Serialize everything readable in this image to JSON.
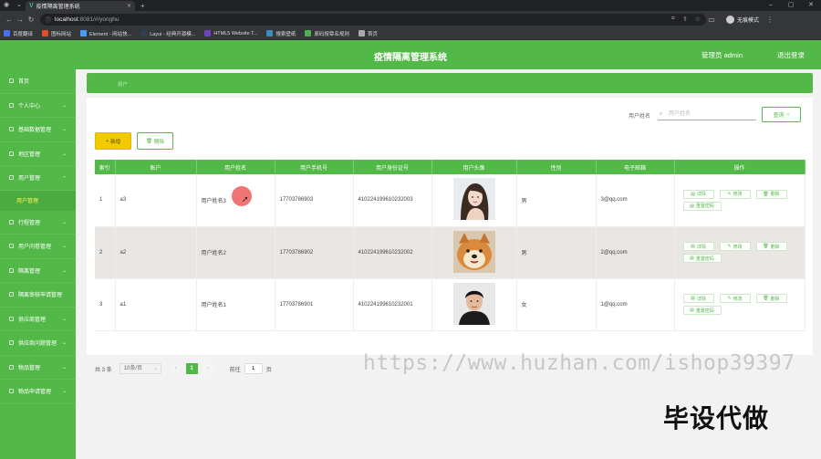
{
  "browser": {
    "tab_title": "疫情隔离管理系统",
    "url_host": "localhost",
    "url_rest": ":8081/#/yonghu",
    "profile_label": "无痕模式",
    "bookmarks": [
      {
        "label": "百度翻译",
        "color": "#4e6ef2"
      },
      {
        "label": "图标网站",
        "color": "#e34c26"
      },
      {
        "label": "Element - 网站快...",
        "color": "#409eff"
      },
      {
        "label": "Layui - 经典开源模...",
        "color": "#2f4056"
      },
      {
        "label": "HTML5 Website T...",
        "color": "#6f42c1"
      },
      {
        "label": "搜索壁纸",
        "color": "#3c8dbc"
      },
      {
        "label": "原码按章名规则",
        "color": "#4caf50"
      },
      {
        "label": "首页",
        "color": "#aaaaaa"
      }
    ]
  },
  "header": {
    "title": "疫情隔离管理系统",
    "user_label": "管理员 admin",
    "logout_label": "退出登录"
  },
  "sidebar": {
    "items": [
      {
        "label": "首页",
        "has_chevron": false,
        "open": false
      },
      {
        "label": "个人中心",
        "has_chevron": true,
        "open": false
      },
      {
        "label": "基础数据管理",
        "has_chevron": true,
        "open": false
      },
      {
        "label": "地区管理",
        "has_chevron": true,
        "open": false
      },
      {
        "label": "用户管理",
        "has_chevron": true,
        "open": true,
        "sub": "用户管理"
      },
      {
        "label": "行程管理",
        "has_chevron": true,
        "open": false
      },
      {
        "label": "用户问卷管理",
        "has_chevron": true,
        "open": false
      },
      {
        "label": "隔离管理",
        "has_chevron": true,
        "open": false
      },
      {
        "label": "隔离审核申请管理",
        "has_chevron": false,
        "open": false
      },
      {
        "label": "供应商管理",
        "has_chevron": true,
        "open": false
      },
      {
        "label": "供应商问题管理",
        "has_chevron": true,
        "open": false
      },
      {
        "label": "物品管理",
        "has_chevron": true,
        "open": false
      },
      {
        "label": "物品申请管理",
        "has_chevron": true,
        "open": false
      }
    ]
  },
  "breadcrumb": {
    "text": "用户"
  },
  "search": {
    "label": "用户姓名",
    "placeholder": "用户姓名",
    "value": "",
    "button_label": "查询"
  },
  "toolbar": {
    "add_label": "新增",
    "delete_label": "删除"
  },
  "table": {
    "columns": [
      "索引",
      "账户",
      "用户姓名",
      "用户手机号",
      "用户身份证号",
      "用户头像",
      "性别",
      "电子邮箱",
      "操作"
    ],
    "rows": [
      {
        "index": "1",
        "account": "a3",
        "name": "用户姓名3",
        "phone": "17703786903",
        "idcard": "410224199610232003",
        "avatar": "woman-photo",
        "gender": "男",
        "email": "3@qq.com"
      },
      {
        "index": "2",
        "account": "a2",
        "name": "用户姓名2",
        "phone": "17703786902",
        "idcard": "410224199610232002",
        "avatar": "dog-photo",
        "gender": "男",
        "email": "2@qq.com"
      },
      {
        "index": "3",
        "account": "a1",
        "name": "用户姓名1",
        "phone": "17703786901",
        "idcard": "410224199610232001",
        "avatar": "man-photo",
        "gender": "女",
        "email": "1@qq.com"
      }
    ],
    "actions": {
      "detail": "详情",
      "edit": "修改",
      "delete": "删除",
      "reset": "重置密码"
    }
  },
  "pager": {
    "total_text": "共 3 条",
    "page_size": "10条/页",
    "current_page": "1",
    "goto_label": "前往",
    "goto_value": "1",
    "page_word": "页"
  },
  "watermark": {
    "url": "https://www.huzhan.com/ishop39397",
    "slogan": "毕设代做"
  }
}
